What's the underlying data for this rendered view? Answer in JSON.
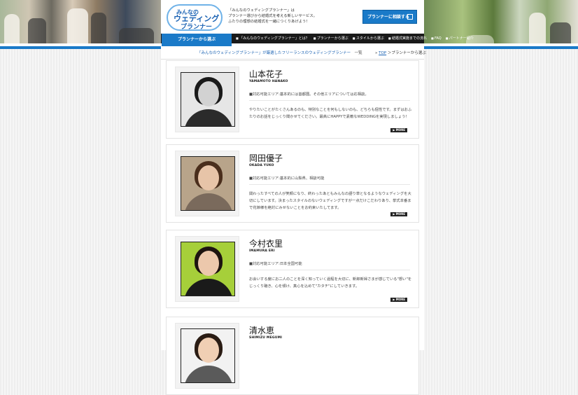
{
  "header": {
    "logo": {
      "line1": "みんなの",
      "line2": "ウェディング",
      "line3": "プランナー"
    },
    "tagline": [
      "「みんなのウェディングプランナー」は",
      "プランナー選びから結婚式を考える新しいサービス。",
      "ふたりの理想の結婚式を一緒につくりあげよう！"
    ],
    "consult_button": "プランナーに相談する",
    "nav_tab": "プランナーから選ぶ",
    "nav_items": [
      "「みんなのウェディングプランナー」とは？",
      "プランナーから選ぶ",
      "スタイルから選ぶ",
      "結婚式実施までの流れ",
      "FAQ",
      "パートナー紹介"
    ]
  },
  "breadcrumb": {
    "main_prefix": "「みんなのウェディングプランナー」が厳選したフリーランスのウェディングプランナー",
    "main_suffix": "一覧",
    "top_link": "TOP",
    "separator": "＞",
    "current": "プランナーから選ぶ",
    "bullet": "»"
  },
  "planners": [
    {
      "name": "山本花子",
      "romaji": "YAMAMOTO HANAKO",
      "area": "■対応可能エリア:基本的には首都圏。その他エリアについては応相談。",
      "description": "やりたいことがたくさんあるのも、特別なことを何もしないのも、どちらも個性です。まずはおふたりのお話をじっくり聞かせてください。最高にHAPPYで素敵なWEDDINGを実現しましょう！",
      "more": "MORE"
    },
    {
      "name": "岡田優子",
      "romaji": "OKADA YUKO",
      "area": "■対応可能エリア:基本的に山梨県、相談可能",
      "description": "関わったすべての人が笑顔になり、終わったあともみんなの語り草となるようなウェディングを大切にしています。決まったスタイルのないウェディングですが一点だけこだわりあり、挙式本番まで花嫁様を絶対にみせないことをお約束いたしてます。",
      "more": "MORE"
    },
    {
      "name": "今村衣里",
      "romaji": "IMAMURA ERI",
      "area": "■対応可能エリア:日本全国可能",
      "description": "お会いする度にお二人のことを深く知っていく過程を大切に、新郎新婦さまが感じている\"想い\"をじっくり聴き、心を傾け、真心を込めて\"カタチ\"にしていきます。",
      "more": "MORE"
    },
    {
      "name": "清水恵",
      "romaji": "SHIMIZU MEGUMI",
      "area": "",
      "description": "",
      "more": ""
    }
  ]
}
